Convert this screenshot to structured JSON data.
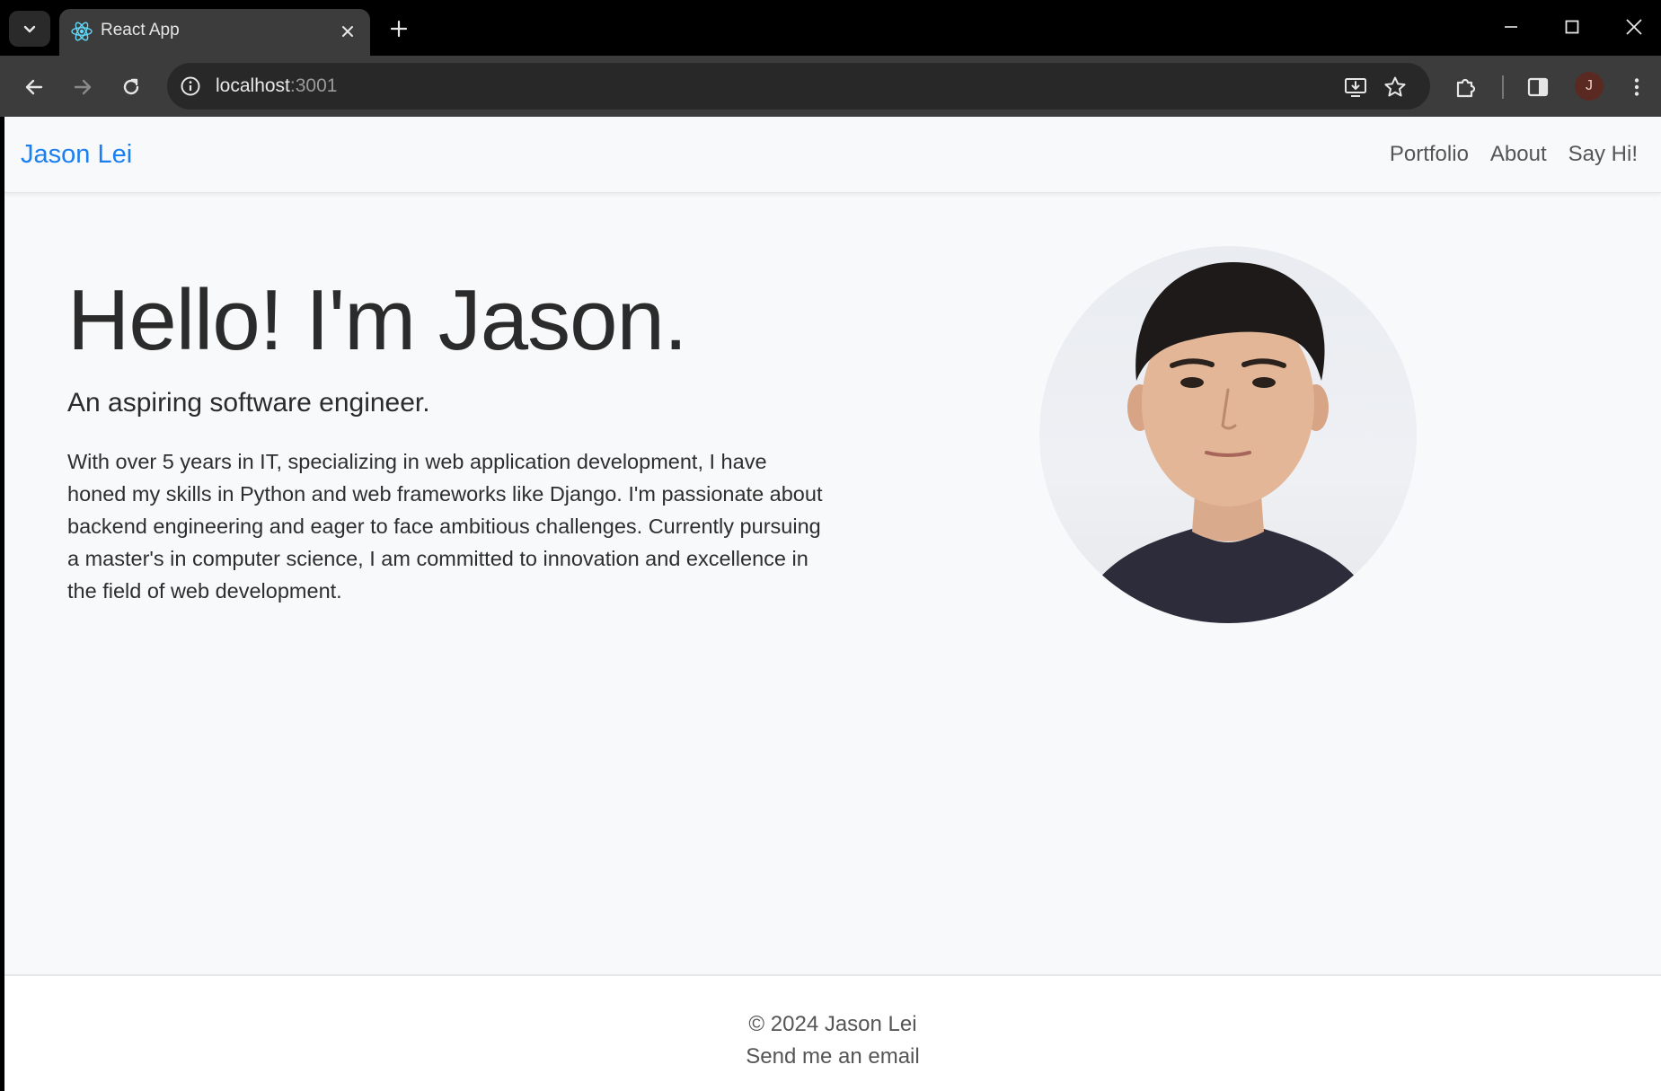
{
  "browser": {
    "tab": {
      "title": "React App",
      "favicon": "react-logo-icon"
    },
    "address": {
      "host": "localhost",
      "port": ":3001"
    },
    "avatar_initial": "J"
  },
  "site": {
    "brand": "Jason Lei",
    "nav": [
      {
        "label": "Portfolio"
      },
      {
        "label": "About"
      },
      {
        "label": "Say Hi!"
      }
    ]
  },
  "hero": {
    "title": "Hello! I'm Jason.",
    "subtitle": "An aspiring software engineer.",
    "body": "With over 5 years in IT, specializing in web application development, I have honed my skills in Python and web frameworks like Django. I'm passionate about backend engineering and eager to face ambitious challenges. Currently pursuing a master's in computer science, I am committed to innovation and excellence in the field of web development."
  },
  "footer": {
    "copyright": "© 2024 Jason Lei",
    "email_link": "Send me an email"
  },
  "colors": {
    "brand": "#1a7ff2",
    "page_bg": "#f8f9fa",
    "text": "#2b2b2b",
    "chrome_bg": "#000000",
    "toolbar_bg": "#3c3c3c"
  }
}
